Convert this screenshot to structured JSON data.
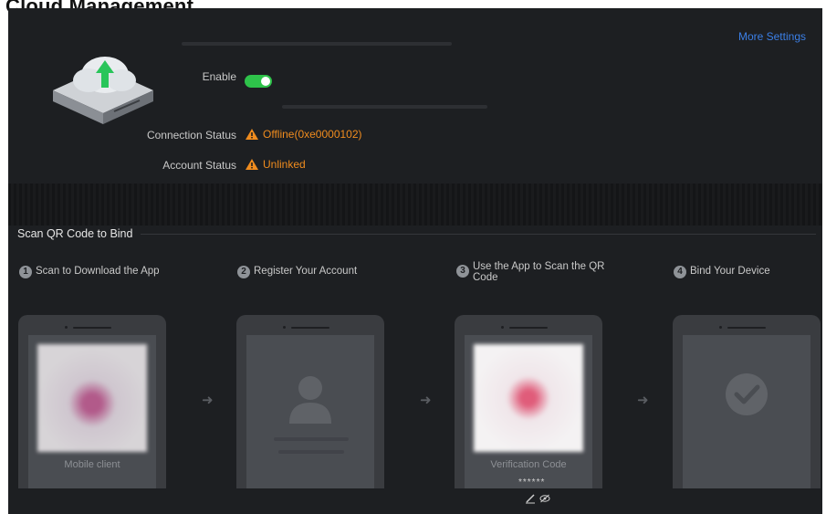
{
  "page_title": "Cloud Management",
  "cloud": {
    "enable_label": "Enable",
    "enable_state": "on",
    "more_settings": "More Settings",
    "connection_status_label": "Connection Status",
    "connection_status_value": "Offline(0xe0000102)",
    "account_status_label": "Account Status",
    "account_status_value": "Unlinked"
  },
  "scan": {
    "title": "Scan QR Code to Bind",
    "steps": [
      {
        "num": "1",
        "text": "Scan to Download the App",
        "caption": "Mobile client"
      },
      {
        "num": "2",
        "text": "Register Your Account",
        "caption": ""
      },
      {
        "num": "3",
        "text": "Use the App to Scan the QR Code",
        "caption": "Verification Code"
      },
      {
        "num": "4",
        "text": "Bind Your Device",
        "caption": ""
      }
    ],
    "verification_code": "******"
  },
  "colors": {
    "accent_green": "#2ec24a",
    "warning_orange": "#f08c1e",
    "link_blue": "#3b7fe6",
    "panel_bg": "#1d1f22"
  },
  "icons": [
    "cloud-nvr-icon",
    "warning-icon",
    "user-icon",
    "check-circle-icon",
    "arrow-right-icon",
    "edit-icon",
    "eye-hide-icon"
  ]
}
